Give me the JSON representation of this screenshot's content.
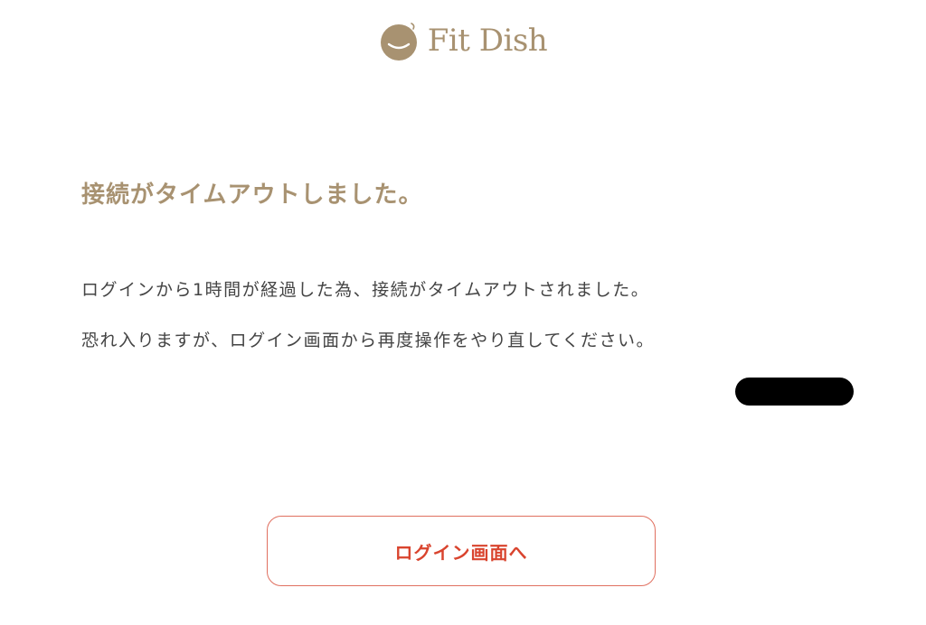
{
  "header": {
    "logo_text": "Fit Dish",
    "logo_icon": "smiling-bowl-icon"
  },
  "message": {
    "title": "接続がタイムアウトしました。",
    "line1": "ログインから1時間が経過した為、接続がタイムアウトされました。",
    "line2": "恐れ入りますが、ログイン画面から再度操作をやり直してください。"
  },
  "actions": {
    "login_button_label": "ログイン画面へ"
  },
  "colors": {
    "brand": "#a89271",
    "accent": "#d9442e",
    "button_border": "#e07060",
    "body_text": "#444444",
    "redaction": "#000000"
  }
}
